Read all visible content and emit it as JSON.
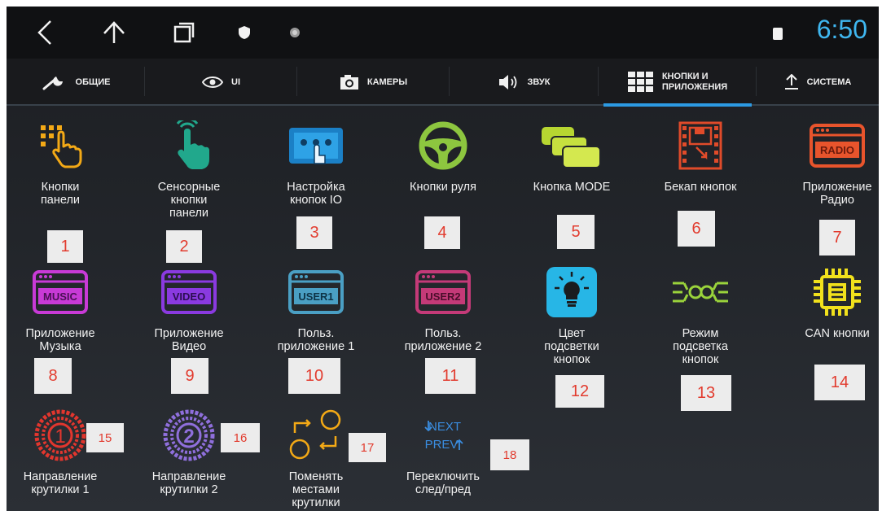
{
  "status_bar": {
    "time": "6:50",
    "nav": [
      "back-icon",
      "home-icon",
      "recents-icon",
      "shield-icon",
      "dot-icon"
    ]
  },
  "tabs": [
    {
      "label": "ОБЩИЕ",
      "icon": "wrench-icon"
    },
    {
      "label": "UI",
      "icon": "eye-icon"
    },
    {
      "label": "КАМЕРЫ",
      "icon": "camera-icon"
    },
    {
      "label": "ЗВУК",
      "icon": "speaker-icon"
    },
    {
      "label": "КНОПКИ И\nПРИЛОЖЕНИЯ",
      "icon": "grid-icon",
      "active": true
    },
    {
      "label": "СИСТЕМА",
      "icon": "upload-icon"
    }
  ],
  "items": [
    {
      "label": "Кнопки\nпанели",
      "number": "1",
      "icon": "panel-buttons-icon"
    },
    {
      "label": "Сенсорные\nкнопки\nпанели",
      "number": "2",
      "icon": "touch-icon"
    },
    {
      "label": "Настройка\nкнопок IO",
      "number": "3",
      "icon": "io-buttons-icon"
    },
    {
      "label": "Кнопки руля",
      "number": "4",
      "icon": "steering-wheel-icon"
    },
    {
      "label": "Кнопка MODE",
      "number": "5",
      "icon": "mode-icon"
    },
    {
      "label": "Бекап кнопок",
      "number": "6",
      "icon": "backup-icon"
    },
    {
      "label": "Приложение\nРадио",
      "number": "7",
      "icon": "radio-app-icon",
      "icon_text": "RADIO"
    },
    {
      "label": "Приложение\nМузыка",
      "number": "8",
      "icon": "music-app-icon",
      "icon_text": "MUSIC"
    },
    {
      "label": "Приложение\nВидео",
      "number": "9",
      "icon": "video-app-icon",
      "icon_text": "VIDEO"
    },
    {
      "label": "Польз.\nприложение 1",
      "number": "10",
      "icon": "user1-app-icon",
      "icon_text": "USER1"
    },
    {
      "label": "Польз.\nприложение 2",
      "number": "11",
      "icon": "user2-app-icon",
      "icon_text": "USER2"
    },
    {
      "label": "Цвет\nподсветки\nкнопок",
      "number": "12",
      "icon": "bulb-icon"
    },
    {
      "label": "Режим\nподсветка\nкнопок",
      "number": "13",
      "icon": "light-mode-icon"
    },
    {
      "label": "CAN кнопки",
      "number": "14",
      "icon": "chip-icon"
    },
    {
      "label": "Направление\nкрутилки 1",
      "number": "15",
      "icon": "knob1-icon",
      "icon_text": "1"
    },
    {
      "label": "Направление\nкрутилки 2",
      "number": "16",
      "icon": "knob2-icon",
      "icon_text": "2"
    },
    {
      "label": "Поменять\nместами\nкрутилки",
      "number": "17",
      "icon": "swap-icon"
    },
    {
      "label": "Переключить\nслед/пред",
      "number": "18",
      "icon": "next-prev-icon",
      "icon_text_1": "NEXT",
      "icon_text_2": "PREV"
    }
  ],
  "colors": {
    "accent": "#2c9ae3",
    "clock": "#3fb7f0",
    "number_text": "#e23b2e",
    "number_bg": "#ececec"
  }
}
